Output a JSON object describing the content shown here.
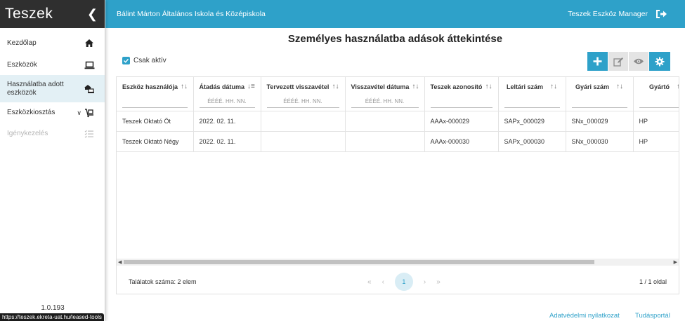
{
  "sidebar": {
    "title": "Teszek",
    "items": [
      {
        "label": "Kezdőlap"
      },
      {
        "label": "Eszközök"
      },
      {
        "label": "Használatba adott eszközök"
      },
      {
        "label": "Eszközkiosztás"
      },
      {
        "label": "Igénykezelés"
      }
    ],
    "version": "1.0.193"
  },
  "status_url": "https://teszek.ekreta-uat.hu/leased-tools",
  "topbar": {
    "school": "Bálint Márton Általános Iskola és Középiskola",
    "app_name": "Teszek Eszköz Manager"
  },
  "page": {
    "title": "Személyes használatba adások áttekintése",
    "only_active_label": "Csak aktív"
  },
  "table": {
    "columns": [
      {
        "label": "Eszköz használója",
        "filter": ""
      },
      {
        "label": "Átadás dátuma",
        "filter": "ÉÉÉÉ. HH. NN."
      },
      {
        "label": "Tervezett visszavétel",
        "filter": "ÉÉÉÉ. HH. NN."
      },
      {
        "label": "Visszavétel dátuma",
        "filter": "ÉÉÉÉ. HH. NN."
      },
      {
        "label": "Teszek azonosító",
        "filter": ""
      },
      {
        "label": "Leltári szám",
        "filter": ""
      },
      {
        "label": "Gyári szám",
        "filter": ""
      },
      {
        "label": "Gyártó",
        "filter": ""
      }
    ],
    "rows": [
      [
        "Teszek Oktató Öt",
        "2022. 02. 11.",
        "",
        "",
        "AAAx-000029",
        "SAPx_000029",
        "SNx_000029",
        "HP"
      ],
      [
        "Teszek Oktató Négy",
        "2022. 02. 11.",
        "",
        "",
        "AAAx-000030",
        "SAPx_000030",
        "SNx_000030",
        "HP"
      ]
    ]
  },
  "pager": {
    "count_text": "Találatok száma: 2 elem",
    "current_page": "1",
    "info": "1 / 1 oldal"
  },
  "footer": {
    "privacy": "Adatvédelmi nyilatkozat",
    "kb": "Tudásportál"
  },
  "colors": {
    "accent": "#2ea1c9",
    "sidebar_header": "#2f2f2f",
    "active_item_bg": "#e3f0f5"
  }
}
